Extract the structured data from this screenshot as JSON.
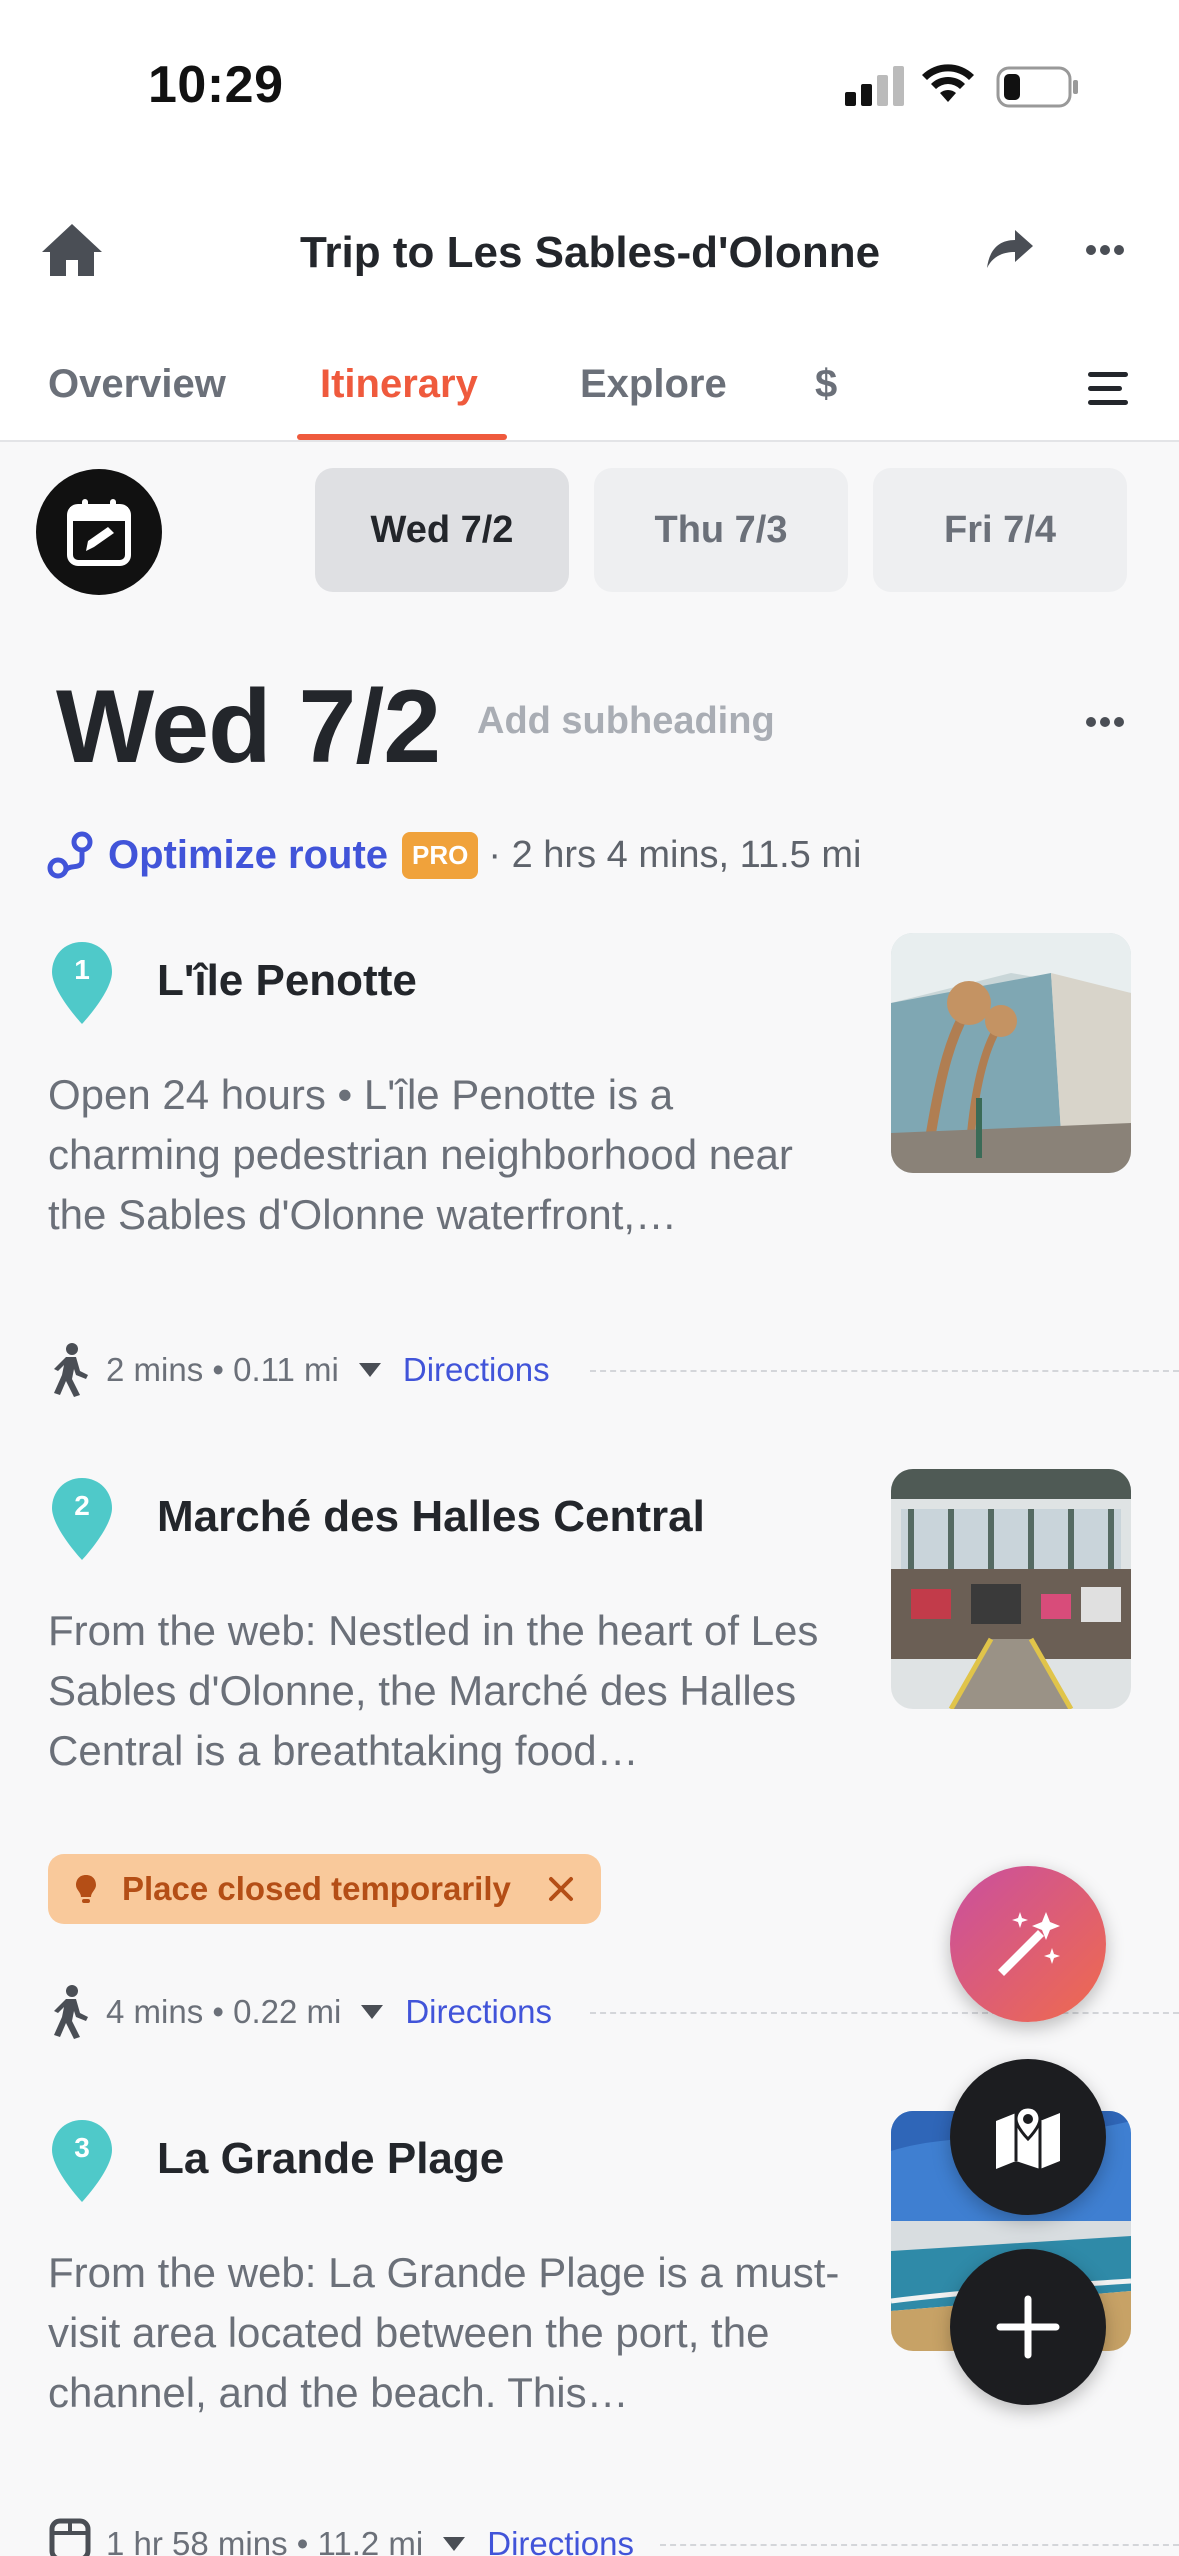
{
  "status_bar": {
    "time": "10:29"
  },
  "header": {
    "title": "Trip to Les Sables-d'Olonne"
  },
  "tabs": [
    {
      "label": "Overview",
      "active": false
    },
    {
      "label": "Itinerary",
      "active": true
    },
    {
      "label": "Explore",
      "active": false
    },
    {
      "label": "$",
      "active": false
    }
  ],
  "days": [
    {
      "label": "Wed 7/2",
      "selected": true
    },
    {
      "label": "Thu 7/3",
      "selected": false
    },
    {
      "label": "Fri 7/4",
      "selected": false
    }
  ],
  "day": {
    "heading": "Wed 7/2",
    "subheading_placeholder": "Add subheading",
    "optimize_label": "Optimize route",
    "pro_badge": "PRO",
    "route_summary": "· 2 hrs 4 mins, 11.5 mi"
  },
  "places": [
    {
      "number": "1",
      "name": "L'île Penotte",
      "description": "Open 24 hours • L'île Penotte is a charming pedestrian neighborhood near the Sables d'Olonne waterfront,…",
      "image": "mosaic-wall-photo"
    },
    {
      "number": "2",
      "name": "Marché des Halles Central",
      "description": "From the web: Nestled in the heart of Les Sables d'Olonne, the Marché des Halles Central is a breathtaking food…",
      "image": "market-hall-photo",
      "alert": "Place closed temporarily"
    },
    {
      "number": "3",
      "name": "La Grande Plage",
      "description": "From the web: La Grande Plage is a must-visit area located between the port, the channel, and the beach. This…",
      "image": "beach-photo"
    }
  ],
  "legs": [
    {
      "mode": "walk",
      "summary": "2 mins • 0.11 mi",
      "directions_label": "Directions"
    },
    {
      "mode": "walk",
      "summary": "4 mins • 0.22 mi",
      "directions_label": "Directions"
    },
    {
      "mode": "transit",
      "summary": "1 hr 58 mins • 11.2 mi",
      "directions_label": "Directions"
    }
  ],
  "colors": {
    "accent": "#ef5a3d",
    "link": "#4154d9",
    "pin": "#4fc9c9",
    "pro": "#f0a23b",
    "alert_bg": "#f9c99b",
    "alert_text": "#b44e16"
  }
}
